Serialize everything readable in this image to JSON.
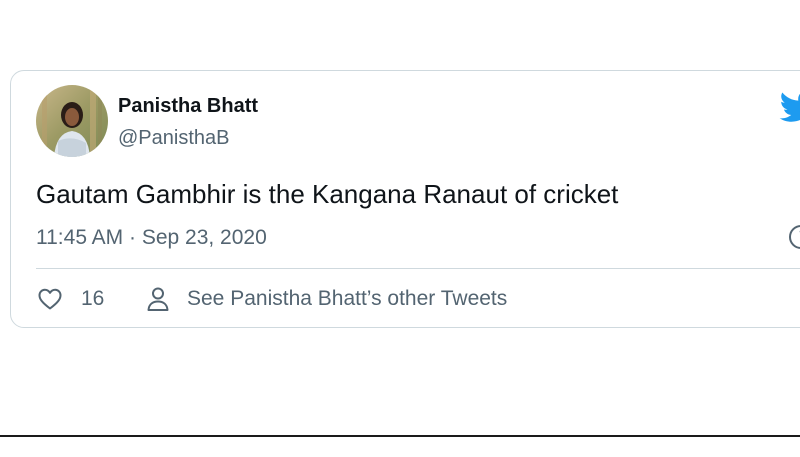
{
  "tweet": {
    "author": {
      "name": "Panistha Bhatt",
      "handle": "@PanisthaB",
      "avatar_icon": "user-photo-avatar"
    },
    "text": "Gautam Gambhir is the Kangana Ranaut of cricket",
    "timestamp": "11:45 AM · Sep 23, 2020",
    "likes": "16",
    "other_tweets_label": "See Panistha Bhatt’s other Tweets",
    "icons": {
      "brand": "twitter-bird-icon",
      "like": "heart-icon",
      "profile": "person-icon",
      "info": "info-icon"
    }
  },
  "colors": {
    "brand": "#1d9bf0",
    "text_primary": "#0f1419",
    "text_secondary": "#536471",
    "border": "#cfd9de"
  }
}
